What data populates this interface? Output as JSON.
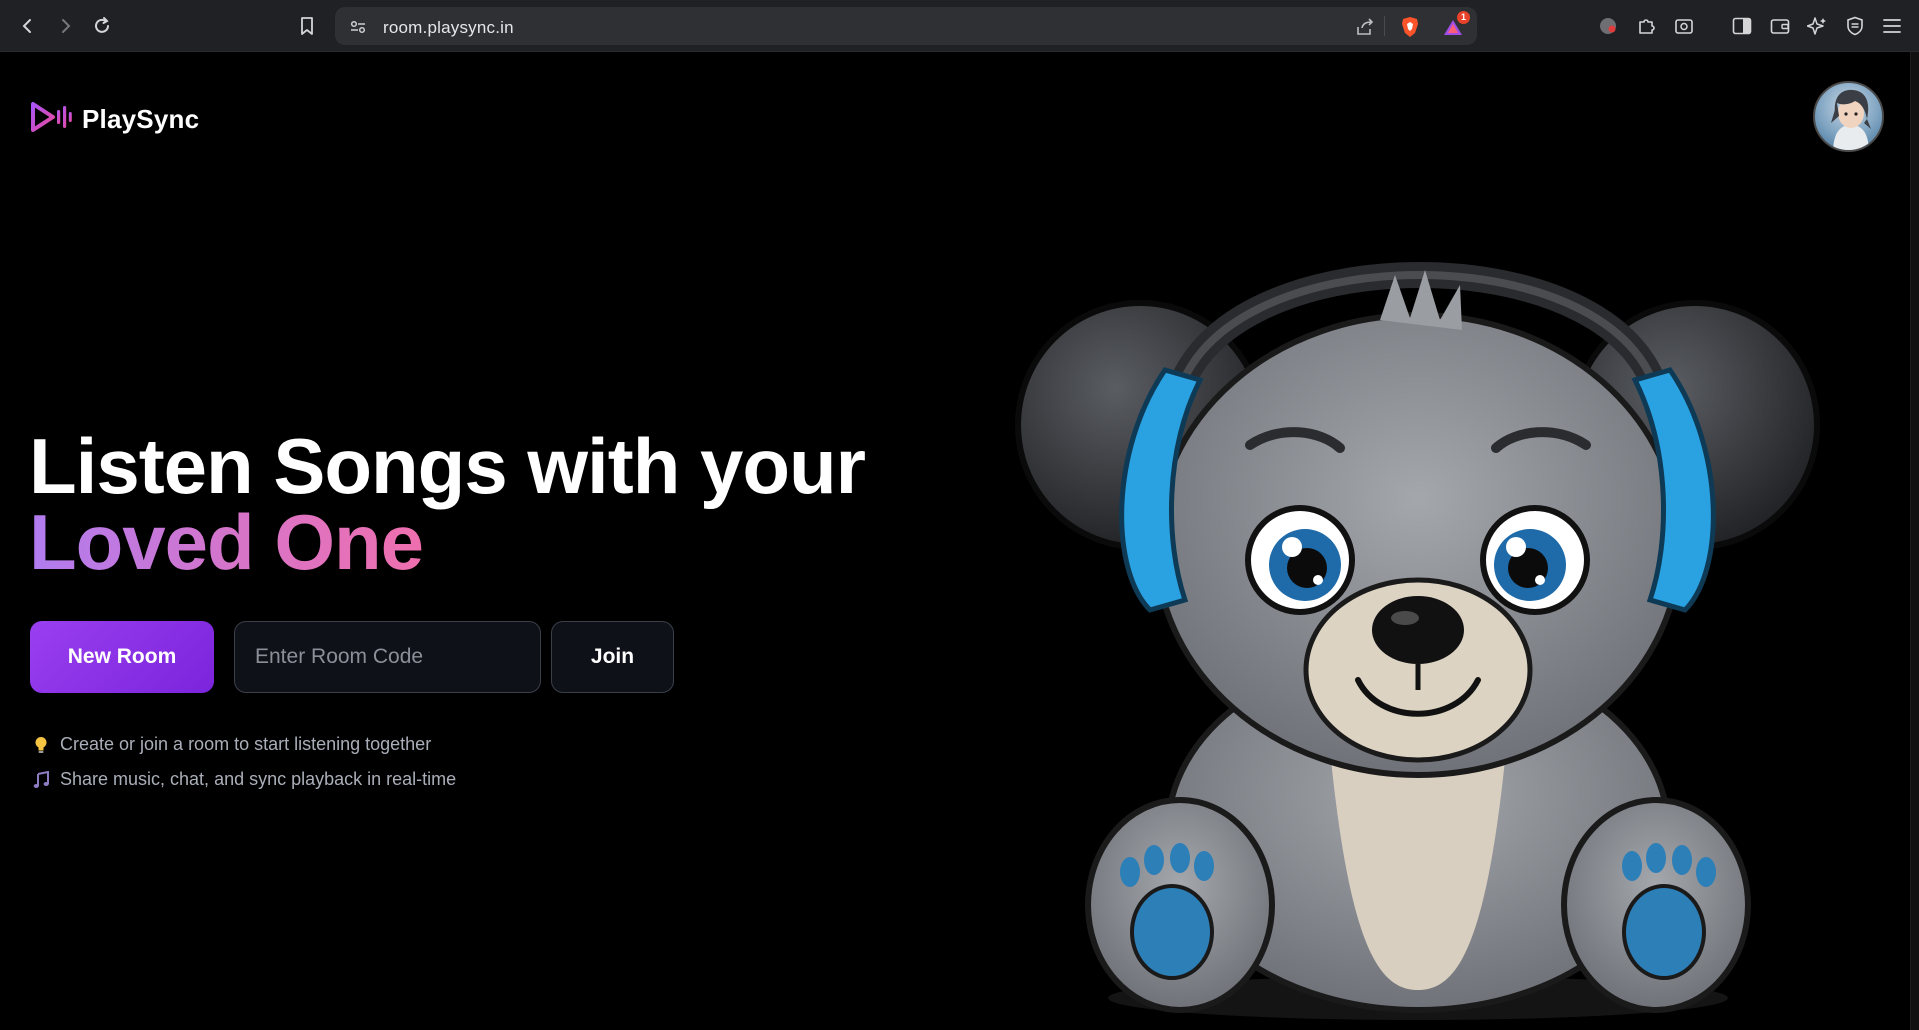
{
  "browser": {
    "url": "room.playsync.in",
    "notification_count": "1",
    "icons": [
      "back-icon",
      "forward-icon",
      "reload-icon",
      "bookmark-icon",
      "site-settings-icon",
      "share-icon",
      "brave-shield-icon",
      "brave-rewards-icon",
      "extension-icon",
      "puzzle-icon",
      "screenshot-icon",
      "sidebar-icon",
      "wallet-icon",
      "leo-ai-icon",
      "vpn-icon",
      "menu-icon"
    ]
  },
  "app": {
    "name": "PlaySync"
  },
  "hero": {
    "title_line1": "Listen Songs with your",
    "title_line2": "Loved One"
  },
  "actions": {
    "new_room_label": "New Room",
    "room_code_placeholder": "Enter Room Code",
    "join_label": "Join"
  },
  "tips": [
    {
      "icon": "lightbulb-icon",
      "text": "Create or join a room to start listening together"
    },
    {
      "icon": "music-note-icon",
      "text": "Share music, chat, and sync playback in real-time"
    }
  ],
  "colors": {
    "accent": "#8b2ee6",
    "gradient_start": "#b07cf0",
    "gradient_end": "#ef6fae",
    "background": "#000000"
  }
}
